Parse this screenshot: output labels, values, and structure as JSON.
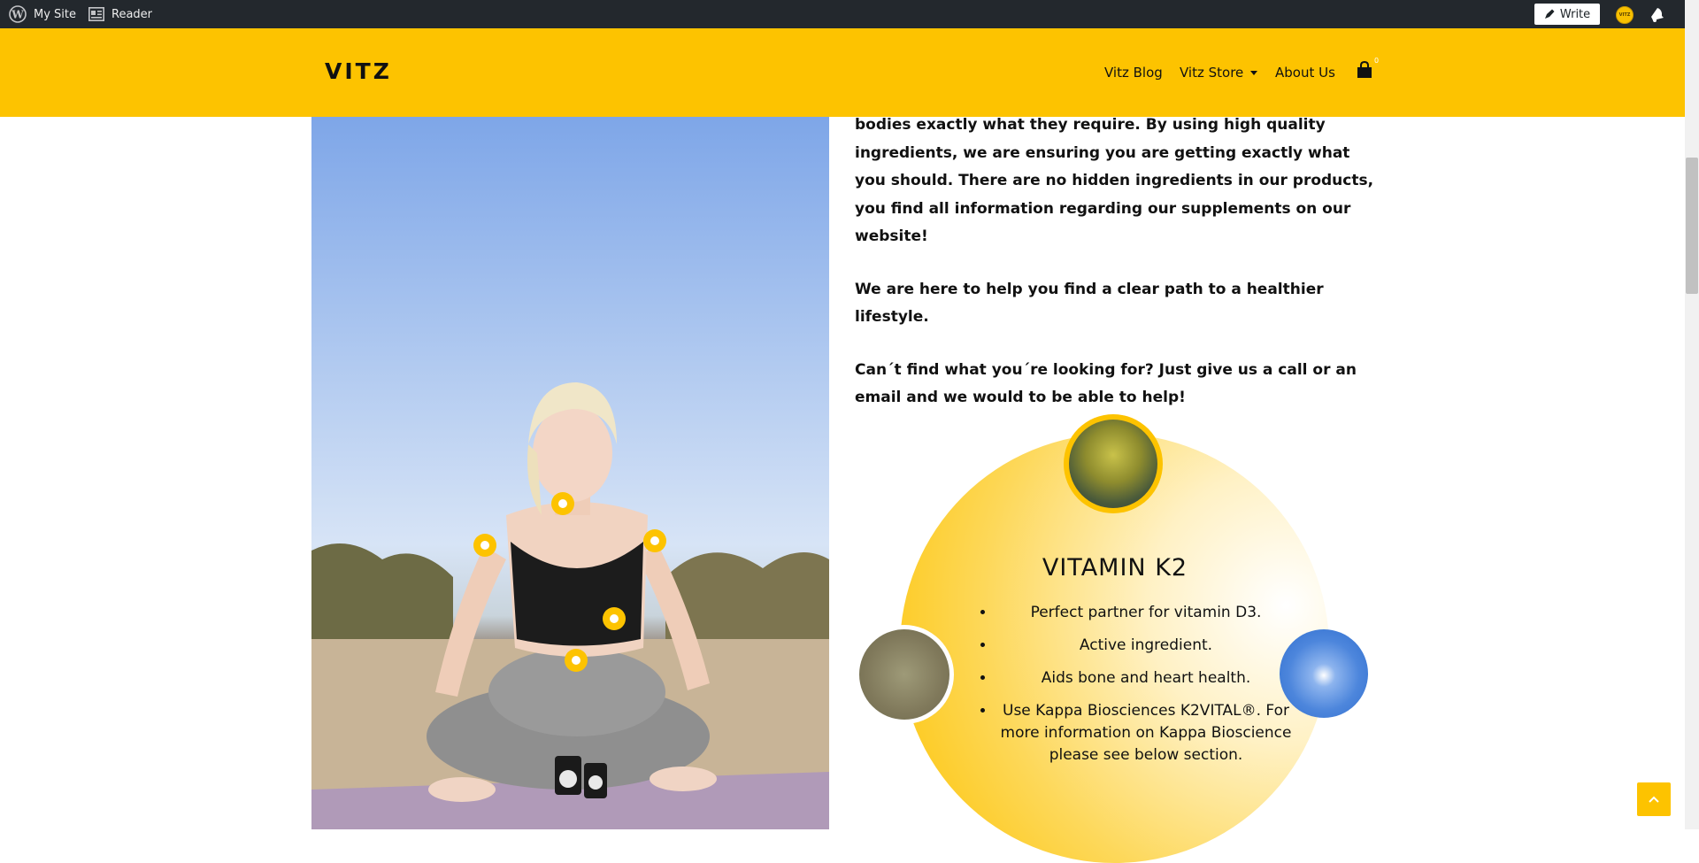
{
  "admin_bar": {
    "my_site_label": "My Site",
    "reader_label": "Reader",
    "write_label": "Write",
    "avatar_text": "VITZ"
  },
  "header": {
    "logo": "VITZ",
    "nav": {
      "blog": "Vitz Blog",
      "store": "Vitz Store",
      "about": "About Us"
    },
    "cart_count": "0"
  },
  "content": {
    "paragraphs": [
      "bodies exactly what they require. By using high quality ingredients, we are ensuring you are getting exactly what you should. There are no hidden ingredients in our products, you find all information regarding our supplements on our website!",
      "We are here to help you find a clear path to a healthier lifestyle.",
      "Can´t find what you´re looking for? Just give us a call or an email and we would to be able to help!"
    ]
  },
  "vitamin": {
    "title": "VITAMIN K2",
    "items": [
      "Perfect partner for vitamin D3.",
      "Active ingredient.",
      "Aids bone and heart health.",
      "Use Kappa Biosciences K2VITAL®. For more information on Kappa Bioscience please see below section."
    ]
  },
  "colors": {
    "brand_yellow": "#fdc300",
    "admin_bar": "#23282d"
  }
}
